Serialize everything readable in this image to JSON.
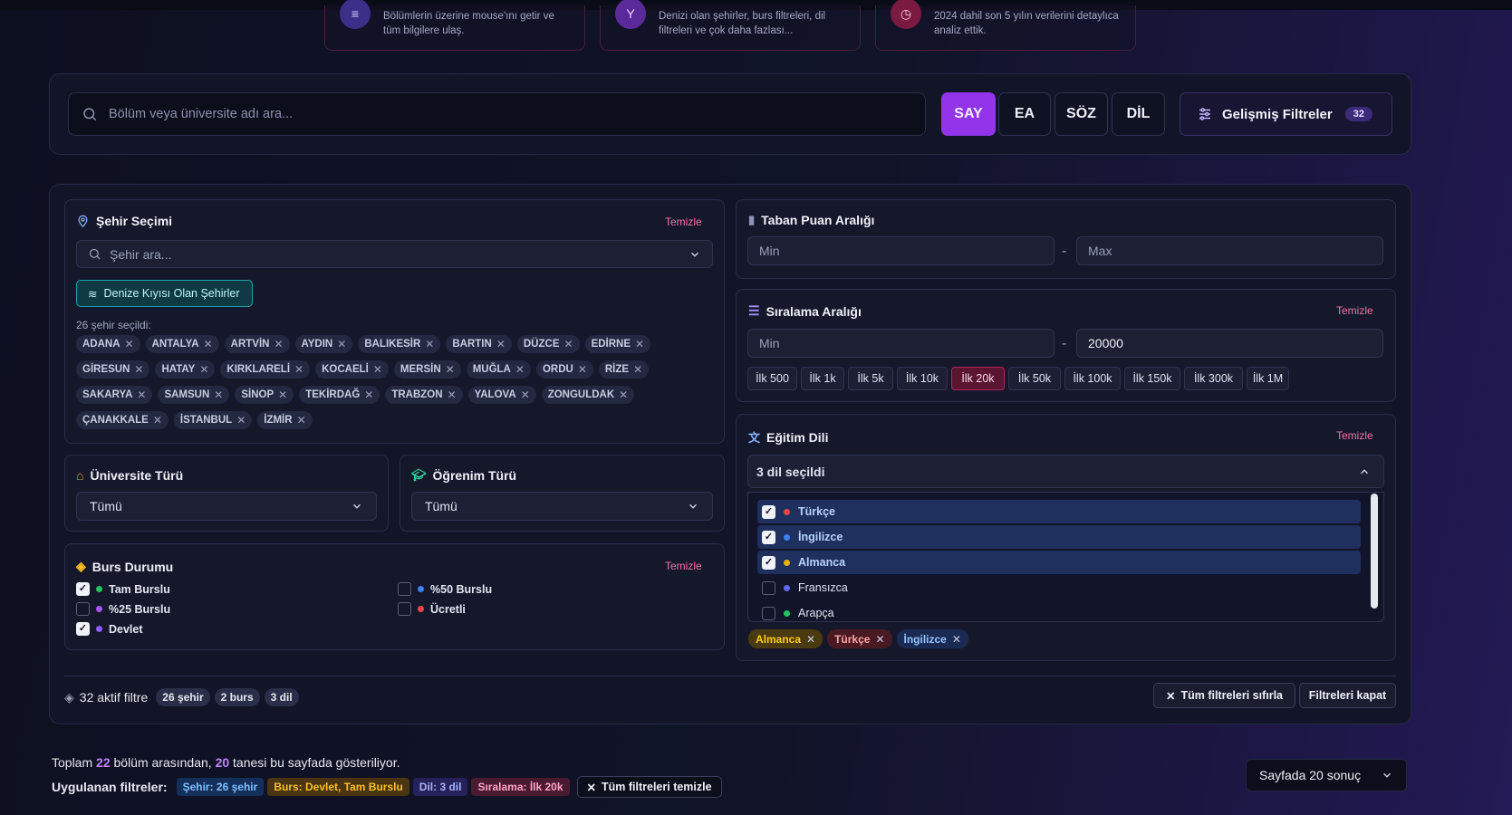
{
  "info_cards": [
    {
      "icon": "list-icon",
      "text": "Bölümlerin üzerine mouse'ını getir ve tüm bilgilere ulaş.",
      "color": "#5b3fd1"
    },
    {
      "icon": "filter-icon",
      "text": "Denizi olan şehirler, burs filtreleri, dil filtreleri ve çok daha fazlası...",
      "color": "#7a34d6"
    },
    {
      "icon": "clock-icon",
      "text": "2024 dahil son 5 yılın verilerini detaylıca analiz ettik.",
      "color": "#b1245a"
    }
  ],
  "search": {
    "placeholder": "Bölüm veya üniversite adı ara..."
  },
  "score_types": [
    "SAY",
    "EA",
    "SÖZ",
    "DİL"
  ],
  "advanced": {
    "label": "Gelişmiş Filtreler",
    "count": "32"
  },
  "city": {
    "title": "Şehir Seçimi",
    "clear": "Temizle",
    "search_placeholder": "Şehir ara...",
    "coastal_button": "Denize Kıyısı Olan Şehirler",
    "selected_text": "26 şehir seçildi:",
    "chips": [
      "ADANA",
      "ANTALYA",
      "ARTVİN",
      "AYDIN",
      "BALIKESİR",
      "BARTIN",
      "DÜZCE",
      "EDİRNE",
      "GİRESUN",
      "HATAY",
      "KIRKLARELİ",
      "KOCAELİ",
      "MERSİN",
      "MUĞLA",
      "ORDU",
      "RİZE",
      "SAKARYA",
      "SAMSUN",
      "SİNOP",
      "TEKİRDAĞ",
      "TRABZON",
      "YALOVA",
      "ZONGULDAK",
      "ÇANAKKALE",
      "İSTANBUL",
      "İZMİR"
    ]
  },
  "university_type": {
    "title": "Üniversite Türü",
    "value": "Tümü"
  },
  "education_type": {
    "title": "Öğrenim Türü",
    "value": "Tümü"
  },
  "scholarship": {
    "title": "Burs Durumu",
    "clear": "Temizle",
    "options": [
      {
        "label": "Tam Burslu",
        "checked": true,
        "color": "#22c55e"
      },
      {
        "label": "%50 Burslu",
        "checked": false,
        "color": "#3b82f6"
      },
      {
        "label": "%25 Burslu",
        "checked": false,
        "color": "#a855f7"
      },
      {
        "label": "Ücretli",
        "checked": false,
        "color": "#ef4444"
      },
      {
        "label": "Devlet",
        "checked": true,
        "color": "#8b5cf6"
      }
    ]
  },
  "base_score": {
    "title": "Taban Puan Aralığı",
    "min_placeholder": "Min",
    "max_placeholder": "Max",
    "dash": "-"
  },
  "ranking": {
    "title": "Sıralama Aralığı",
    "clear": "Temizle",
    "min_placeholder": "Min",
    "max_value": "20000",
    "dash": "-",
    "quick": [
      "İlk 500",
      "İlk 1k",
      "İlk 5k",
      "İlk 10k",
      "İlk 20k",
      "İlk 50k",
      "İlk 100k",
      "İlk 150k",
      "İlk 300k",
      "İlk 1M"
    ],
    "active_quick": "İlk 20k"
  },
  "language": {
    "title": "Eğitim Dili",
    "clear": "Temizle",
    "selected_text": "3 dil seçildi",
    "options": [
      {
        "label": "Türkçe",
        "checked": true,
        "color": "#ef4444"
      },
      {
        "label": "İngilizce",
        "checked": true,
        "color": "#3b82f6"
      },
      {
        "label": "Almanca",
        "checked": true,
        "color": "#eab308"
      },
      {
        "label": "Fransızca",
        "checked": false,
        "color": "#6366f1"
      },
      {
        "label": "Arapça",
        "checked": false,
        "color": "#22c55e"
      }
    ],
    "tags": [
      {
        "label": "Almanca",
        "bg": "#4a3a10",
        "fg": "#facc15"
      },
      {
        "label": "Türkçe",
        "bg": "#4a1a22",
        "fg": "#fca5a5"
      },
      {
        "label": "İngilizce",
        "bg": "#1a2a52",
        "fg": "#93c5fd"
      }
    ]
  },
  "summary": {
    "active_label": "32 aktif filtre",
    "pills": [
      "26 şehir",
      "2 burs",
      "3 dil"
    ],
    "reset_all": "Tüm filtreleri sıfırla",
    "close": "Filtreleri kapat"
  },
  "results": {
    "prefix": "Toplam",
    "total": "22",
    "middle": "bölüm arasından,",
    "shown": "20",
    "suffix": "tanesi bu sayfada gösteriliyor.",
    "applied_label": "Uygulanan filtreler:",
    "applied": [
      {
        "label": "Şehir: 26 şehir",
        "bg": "#14305a",
        "fg": "#7cc0ff"
      },
      {
        "label": "Burs: Devlet, Tam Burslu",
        "bg": "#4a3510",
        "fg": "#fbbf24"
      },
      {
        "label": "Dil: 3 dil",
        "bg": "#27215a",
        "fg": "#a5b4fc"
      },
      {
        "label": "Sıralama: İlk 20k",
        "bg": "#4a1a30",
        "fg": "#fda4c4"
      }
    ],
    "clear_all": "Tüm filtreleri temizle",
    "page_size": "Sayfada 20 sonuç"
  }
}
